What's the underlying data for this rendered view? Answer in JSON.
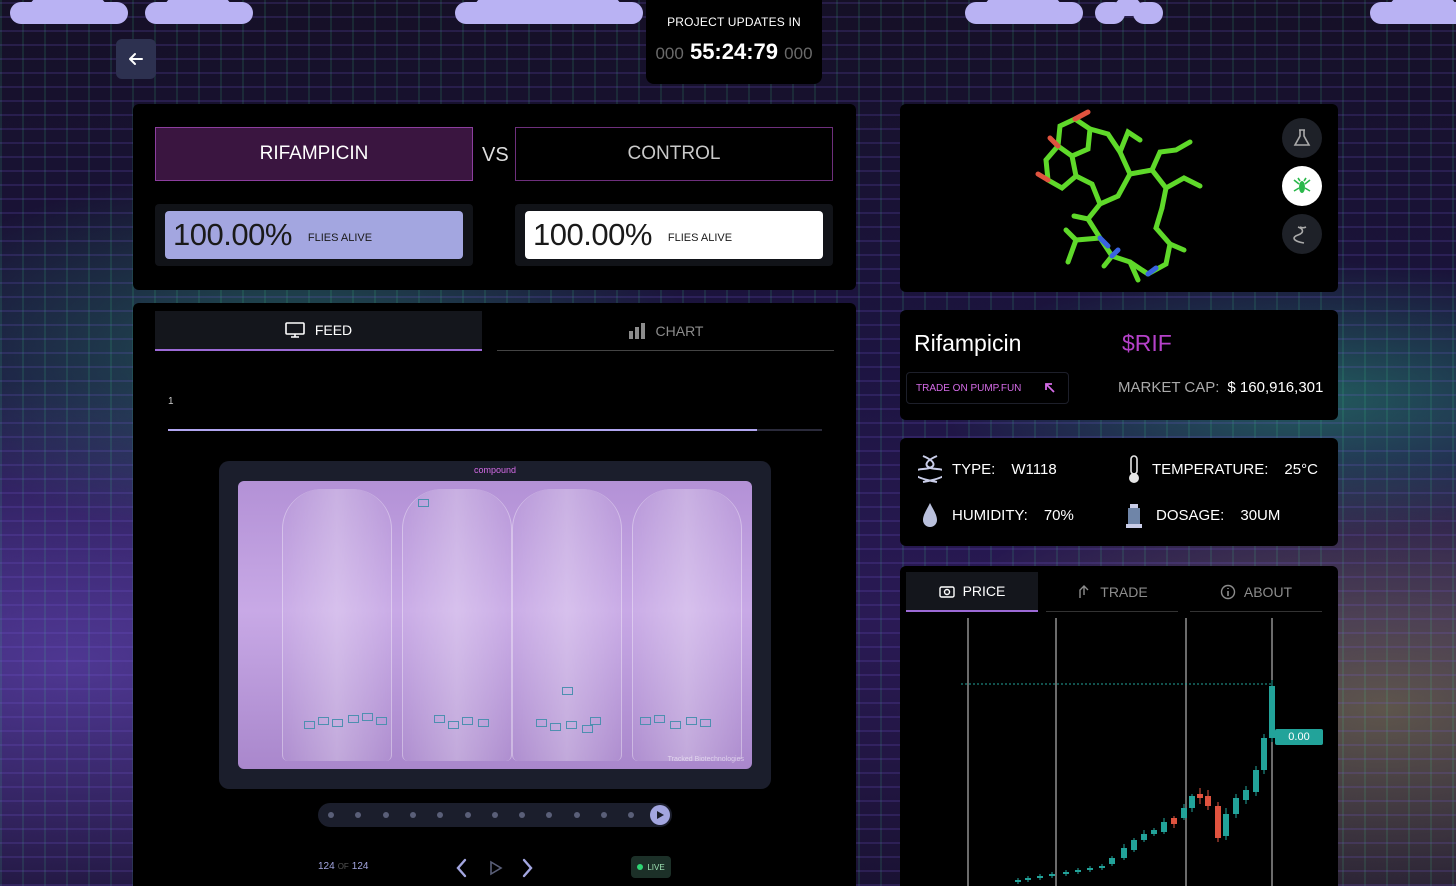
{
  "timer": {
    "label": "PROJECT UPDATES IN",
    "prefix": "000",
    "time": "55:24:79",
    "suffix": "000"
  },
  "versus": {
    "left_name": "RIFAMPICIN",
    "vs": "VS",
    "right_name": "CONTROL",
    "left_percent": "100.00%",
    "left_label": "FLIES ALIVE",
    "right_percent": "100.00%",
    "right_label": "FLIES ALIVE"
  },
  "feed": {
    "tabs": [
      {
        "label": "FEED",
        "icon": "monitor-icon"
      },
      {
        "label": "CHART",
        "icon": "bar-chart-icon"
      }
    ],
    "frame_number": "1",
    "progress": 0.9,
    "video_caption": "compound",
    "watermark": "Tracked Biotechnologies",
    "counter_current": "124",
    "counter_of": "OF",
    "counter_total": "124",
    "live_label": "LIVE",
    "scrubber_dots": 13
  },
  "token": {
    "name": "Rifampicin",
    "ticker": "$RIF",
    "trade_label": "TRADE ON PUMP.FUN",
    "market_cap_label": "MARKET CAP:",
    "market_cap_value": "$ 160,916,301"
  },
  "conditions": {
    "type_label": "TYPE:",
    "type_value": "W1118",
    "temperature_label": "TEMPERATURE:",
    "temperature_value": "25°C",
    "humidity_label": "HUMIDITY:",
    "humidity_value": "70%",
    "dosage_label": "DOSAGE:",
    "dosage_value": "30UM"
  },
  "price": {
    "tabs": [
      {
        "label": "PRICE",
        "icon": "camera-icon"
      },
      {
        "label": "TRADE",
        "icon": "trade-arrow-icon"
      },
      {
        "label": "ABOUT",
        "icon": "info-icon"
      }
    ],
    "last_price_label": "0.00"
  },
  "colors": {
    "accent": "#9c6ad6",
    "magenta": "#d56be7",
    "candle_up": "#22a39a",
    "candle_down": "#e0533f",
    "molecule": "#5fd92a"
  }
}
